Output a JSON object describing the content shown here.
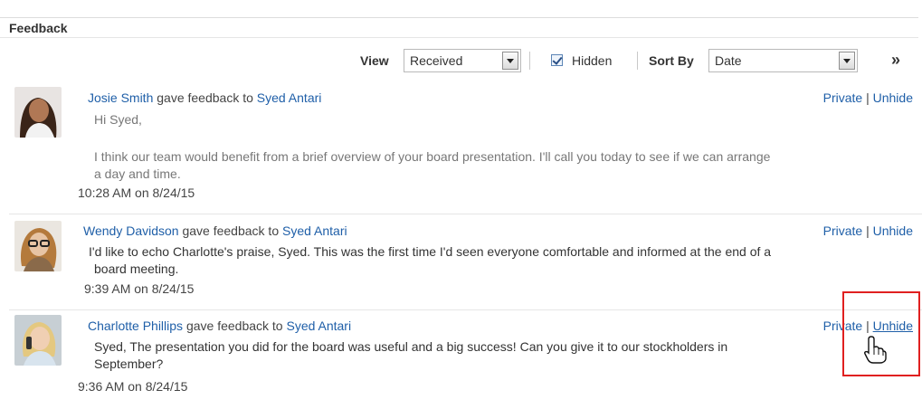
{
  "section": {
    "title": "Feedback"
  },
  "toolbar": {
    "view_label": "View",
    "view_value": "Received",
    "hidden_label": "Hidden",
    "hidden_checked": true,
    "sortby_label": "Sort By",
    "sortby_value": "Date",
    "more_label": "»"
  },
  "entries": [
    {
      "author": "Josie Smith",
      "verb": "gave feedback to",
      "recipient": "Syed Antari",
      "private_label": "Private",
      "separator": "|",
      "unhide_label": "Unhide",
      "line1": "Hi Syed,",
      "line2": "I think our team would benefit from a brief overview of your board presentation. I'll call you today to see if we can arrange",
      "line3": "a day and time.",
      "timestamp": "10:28 AM on 8/24/15"
    },
    {
      "author": "Wendy Davidson",
      "verb": "gave feedback to",
      "recipient": "Syed Antari",
      "private_label": "Private",
      "separator": "|",
      "unhide_label": "Unhide",
      "line1": "I'd like to echo Charlotte's praise, Syed. This was the first time I'd seen everyone comfortable and informed at the end of a",
      "line2": "board meeting.",
      "timestamp": "9:39 AM on 8/24/15"
    },
    {
      "author": "Charlotte Phillips",
      "verb": "gave feedback to",
      "recipient": "Syed Antari",
      "private_label": "Private",
      "separator": "|",
      "unhide_label": "Unhide",
      "line1": "Syed, The presentation you did for the board was useful and a big success! Can you give it to our stockholders in",
      "line2": "September?",
      "timestamp": "9:36 AM on 8/24/15"
    }
  ],
  "colors": {
    "link": "#1f5fa8",
    "highlight": "#e02020"
  }
}
